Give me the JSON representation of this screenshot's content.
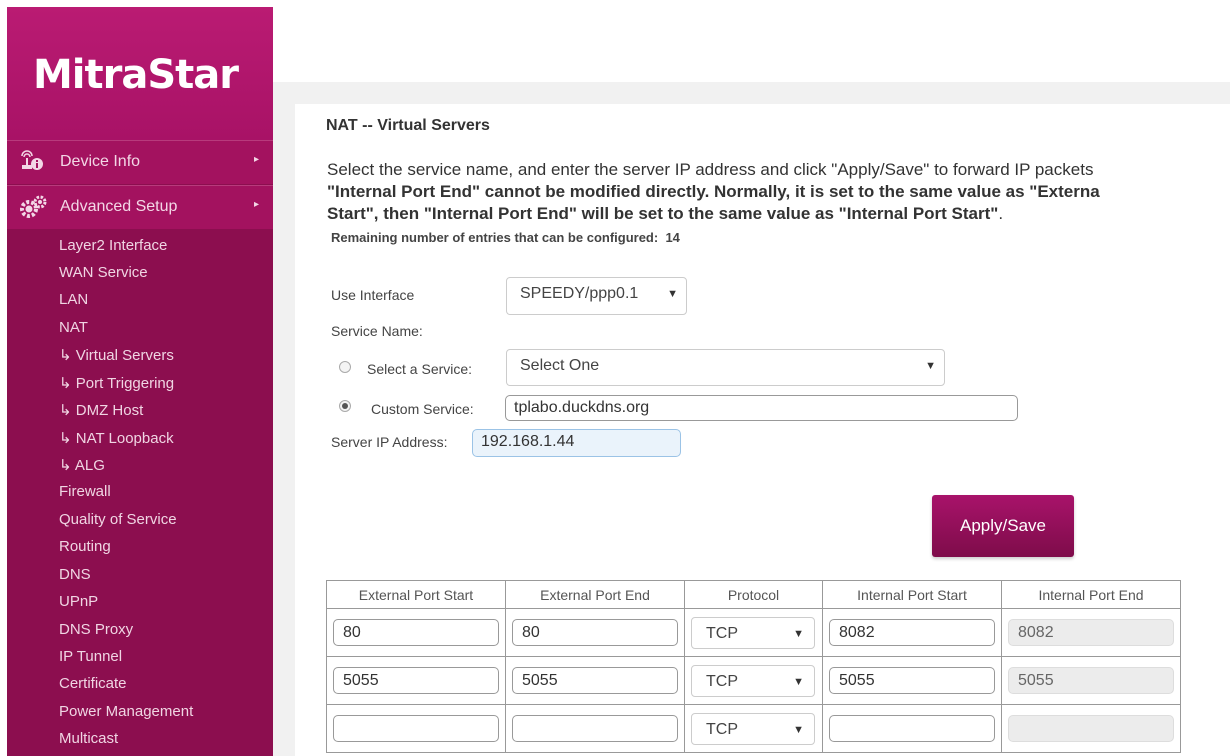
{
  "brand": {
    "logo": "MitraStar"
  },
  "sidebar": {
    "device_info": {
      "label": "Device Info",
      "icon": "antenna-info-icon"
    },
    "advanced_setup": {
      "label": "Advanced Setup",
      "icon": "gears-icon"
    },
    "items": [
      "Layer2 Interface",
      "WAN Service",
      "LAN",
      "NAT",
      "↳ Virtual Servers",
      "↳ Port Triggering",
      "↳ DMZ Host",
      "↳ NAT Loopback",
      "↳ ALG",
      "Firewall",
      "Quality of Service",
      "Routing",
      "DNS",
      "UPnP",
      "DNS Proxy",
      "IP Tunnel",
      "Certificate",
      "Power Management",
      "Multicast"
    ]
  },
  "page": {
    "title": "NAT -- Virtual Servers",
    "desc_line1": "Select the service name, and enter the server IP address and click \"Apply/Save\" to forward IP packets",
    "desc_line2": "\"Internal Port End\" cannot be modified directly. Normally, it is set to the same value as \"Externa",
    "desc_line3_bold": "Start\", then \"Internal Port End\" will be set to the same value as \"Internal Port Start\"",
    "desc_line3_end": ".",
    "remaining_label": "Remaining number of entries that can be configured:",
    "remaining_value": "14"
  },
  "form": {
    "use_interface_label": "Use Interface",
    "use_interface_value": "SPEEDY/ppp0.1",
    "service_name_label": "Service Name:",
    "select_service_label": "Select a Service:",
    "select_service_value": "Select One",
    "custom_service_label": "Custom Service:",
    "custom_service_value": "tplabo.duckdns.org",
    "server_ip_label": "Server IP Address:",
    "server_ip_value": "192.168.1.44",
    "apply_label": "Apply/Save"
  },
  "table": {
    "headers": [
      "External Port Start",
      "External Port End",
      "Protocol",
      "Internal Port Start",
      "Internal Port End"
    ],
    "rows": [
      [
        "80",
        "80",
        "TCP",
        "8082",
        "8082"
      ],
      [
        "5055",
        "5055",
        "TCP",
        "5055",
        "5055"
      ],
      [
        "",
        "",
        "TCP",
        "",
        ""
      ]
    ]
  }
}
